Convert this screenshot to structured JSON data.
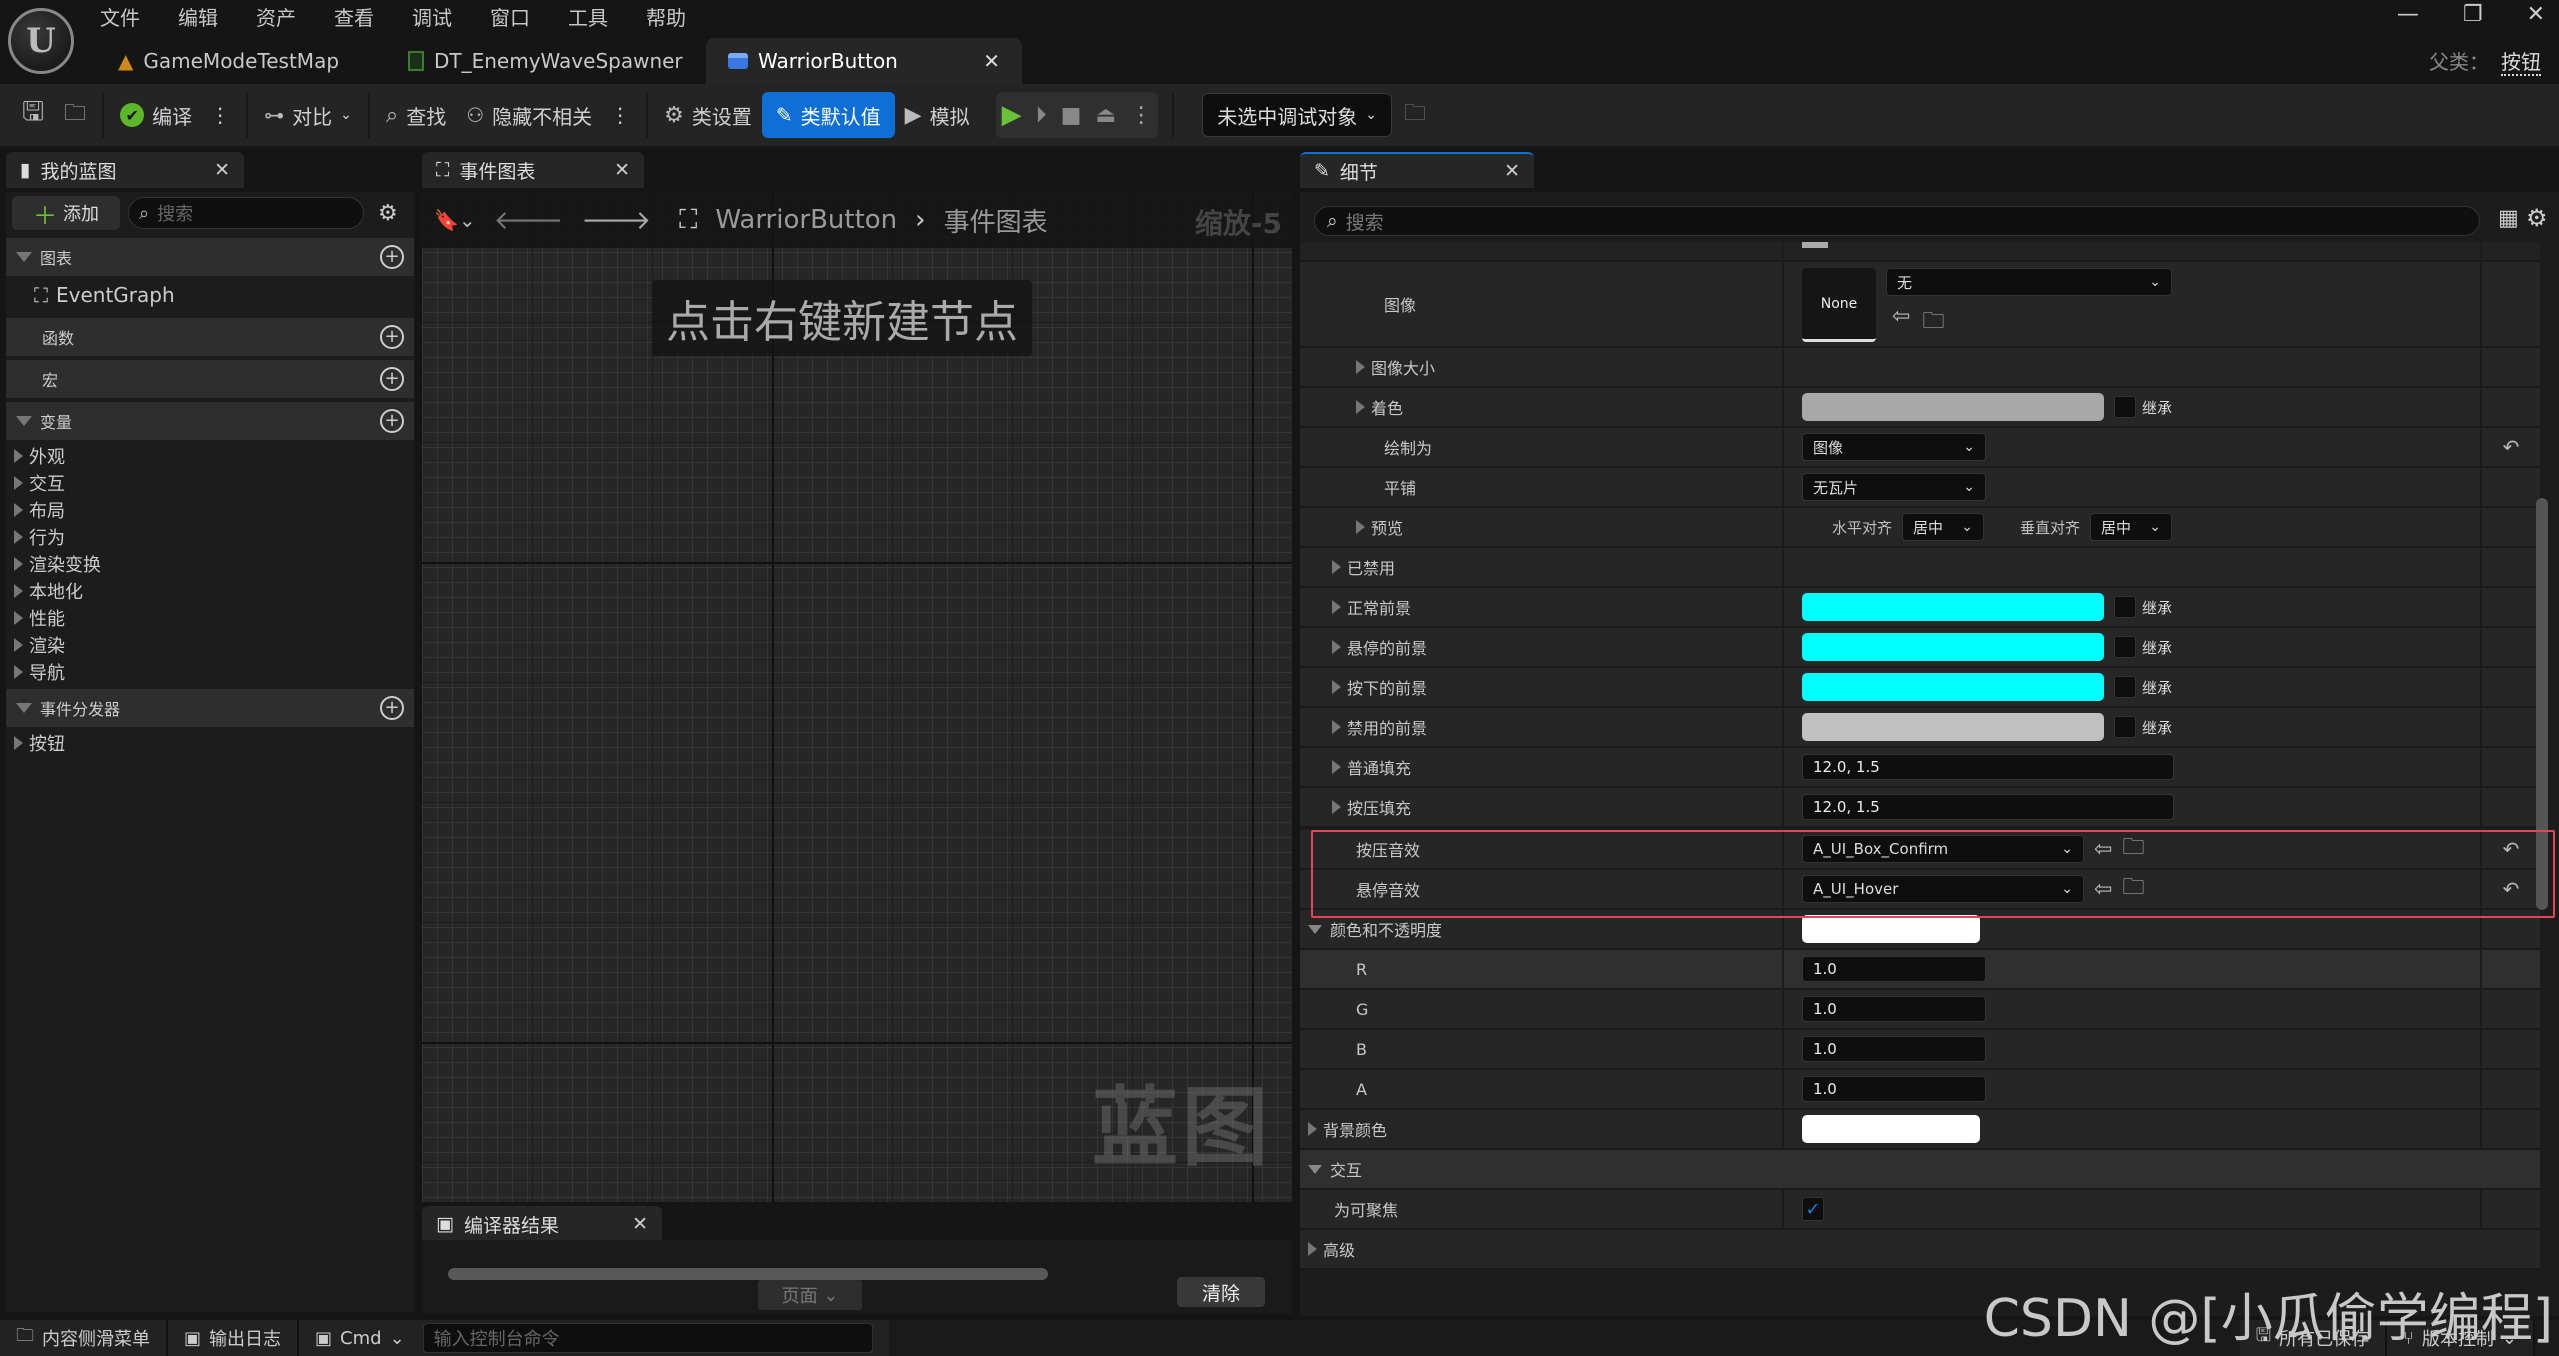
{
  "menu": [
    "文件",
    "编辑",
    "资产",
    "查看",
    "调试",
    "窗口",
    "工具",
    "帮助"
  ],
  "doc_tabs": [
    {
      "label": "GameModeTestMap",
      "icon": "level-icon"
    },
    {
      "label": "DT_EnemyWaveSpawner",
      "icon": "datatable-icon"
    },
    {
      "label": "WarriorButton",
      "icon": "widget-blueprint-icon",
      "active": true
    }
  ],
  "window": {
    "minimize": "—",
    "restore": "❐",
    "close": "✕"
  },
  "parent_class": {
    "label": "父类：",
    "value": "按钮"
  },
  "toolbar": {
    "compile": "编译",
    "diff": "对比",
    "find": "查找",
    "hide_unrelated": "隐藏不相关",
    "class_settings": "类设置",
    "class_defaults": "类默认值",
    "simulate": "模拟",
    "debug_object": "未选中调试对象"
  },
  "my_blueprint": {
    "tab": "我的蓝图",
    "add": "添加",
    "search_placeholder": "搜索",
    "sections": {
      "graphs": "图表",
      "functions": "函数",
      "macros": "宏",
      "variables": "变量",
      "dispatchers": "事件分发器"
    },
    "graph_item": "EventGraph",
    "variable_categories": [
      "外观",
      "交互",
      "布局",
      "行为",
      "渲染变换",
      "本地化",
      "性能",
      "渲染",
      "导航"
    ],
    "dispatcher_items": [
      "按钮"
    ]
  },
  "graph": {
    "tab": "事件图表",
    "breadcrumb_root": "WarriorButton",
    "breadcrumb_leaf": "事件图表",
    "zoom": "缩放-5",
    "hint": "点击右键新建节点",
    "watermark": "蓝图"
  },
  "compiler": {
    "tab": "编译器结果",
    "page": "页面",
    "clear": "清除"
  },
  "details": {
    "tab": "细节",
    "search_placeholder": "搜索",
    "image_label": "图像",
    "image_thumb": "None",
    "image_value": "无",
    "rows": {
      "image_size": "图像大小",
      "tint": {
        "label": "着色",
        "color": "#a8a8a8",
        "inherit": "继承"
      },
      "draw_as": {
        "label": "绘制为",
        "value": "图像"
      },
      "tiling": {
        "label": "平铺",
        "value": "无瓦片"
      },
      "preview": {
        "label": "预览",
        "h_align_label": "水平对齐",
        "h_align": "居中",
        "v_align_label": "垂直对齐",
        "v_align": "居中"
      },
      "disabled": "已禁用",
      "normal_fg": {
        "label": "正常前景",
        "color": "#00ffff",
        "inherit": "继承"
      },
      "hovered_fg": {
        "label": "悬停的前景",
        "color": "#00ffff",
        "inherit": "继承"
      },
      "pressed_fg": {
        "label": "按下的前景",
        "color": "#00ffff",
        "inherit": "继承"
      },
      "disabled_fg": {
        "label": "禁用的前景",
        "color": "#c0c0c0",
        "inherit": "继承"
      },
      "normal_padding": {
        "label": "普通填充",
        "value": "12.0, 1.5"
      },
      "pressed_padding": {
        "label": "按压填充",
        "value": "12.0, 1.5"
      },
      "pressed_sound": {
        "label": "按压音效",
        "value": "A_UI_Box_Confirm"
      },
      "hovered_sound": {
        "label": "悬停音效",
        "value": "A_UI_Hover"
      },
      "color_opacity": {
        "label": "颜色和不透明度",
        "color": "#ffffff"
      },
      "r": {
        "label": "R",
        "value": "1.0"
      },
      "g": {
        "label": "G",
        "value": "1.0"
      },
      "b": {
        "label": "B",
        "value": "1.0"
      },
      "a": {
        "label": "A",
        "value": "1.0"
      },
      "bg_color": {
        "label": "背景颜色",
        "color": "#ffffff"
      },
      "interaction": "交互",
      "focusable": {
        "label": "为可聚焦",
        "checked": true
      },
      "advanced": "高级"
    }
  },
  "status": {
    "content_drawer": "内容侧滑菜单",
    "output_log": "输出日志",
    "cmd": "Cmd",
    "console_placeholder": "输入控制台命令",
    "all_saved": "所有已保存",
    "source_control": "版本控制"
  },
  "watermark_csdn": "CSDN @[小瓜偷学编程]",
  "accent": "#0e70d6"
}
